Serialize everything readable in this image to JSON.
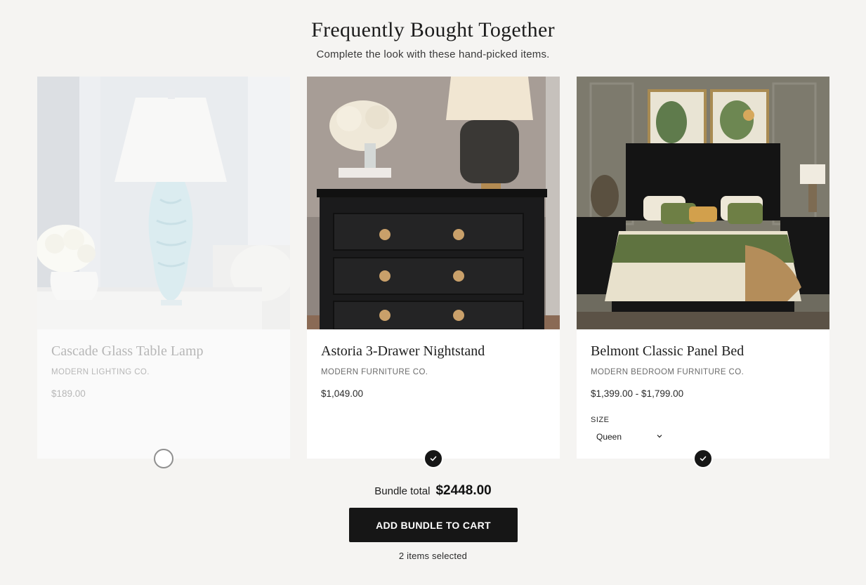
{
  "section": {
    "title": "Frequently Bought Together",
    "subtitle": "Complete the look with these hand-picked items."
  },
  "products": [
    {
      "name": "Cascade Glass Table Lamp",
      "brand": "MODERN LIGHTING CO.",
      "price": "$189.00",
      "selected": false
    },
    {
      "name": "Astoria 3-Drawer Nightstand",
      "brand": "MODERN FURNITURE CO.",
      "price": "$1,049.00",
      "selected": true
    },
    {
      "name": "Belmont Classic Panel Bed",
      "brand": "MODERN BEDROOM FURNITURE CO.",
      "price": "$1,399.00 - $1,799.00",
      "selected": true,
      "option": {
        "label": "SIZE",
        "value": "Queen"
      }
    }
  ],
  "bundle": {
    "total_label": "Bundle total",
    "total_value": "$2448.00",
    "cta_label": "ADD BUNDLE TO CART",
    "selected_text": "2 items selected"
  },
  "colors": {
    "background": "#f5f4f2",
    "button": "#161616",
    "toggle_on": "#161616"
  }
}
